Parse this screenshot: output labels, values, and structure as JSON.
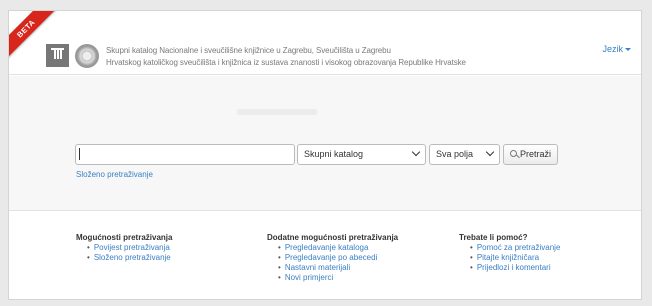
{
  "header": {
    "beta_badge": "BETA",
    "title_line1": "Skupni katalog Nacionalne i sveučilišne knjižnice u Zagrebu, Sveučilišta u Zagrebu",
    "title_line2": "Hrvatskog katoličkog sveučilišta i knjižnica iz sustava znanosti i visokog obrazovanja Republike Hrvatske",
    "language_menu": "Jezik"
  },
  "search": {
    "query_value": "",
    "catalog_select": "Skupni katalog",
    "field_select": "Sva polja",
    "submit_label": "Pretraži",
    "advanced_link": "Složeno pretraživanje"
  },
  "footer": {
    "columns": [
      {
        "heading": "Mogućnosti pretraživanja",
        "links": [
          "Povijest pretraživanja",
          "Složeno pretraživanje"
        ]
      },
      {
        "heading": "Dodatne mogućnosti pretraživanja",
        "links": [
          "Pregledavanje kataloga",
          "Pregledavanje po abecedi",
          "Nastavni materijali",
          "Novi primjerci"
        ]
      },
      {
        "heading": "Trebate li pomoć?",
        "links": [
          "Pomoć za pretraživanje",
          "Pitajte knjižničara",
          "Prijedlozi i komentari"
        ]
      }
    ]
  },
  "colors": {
    "link": "#3b7fc4",
    "beta_ribbon": "#d9261c",
    "search_band": "#f7f7f7"
  }
}
